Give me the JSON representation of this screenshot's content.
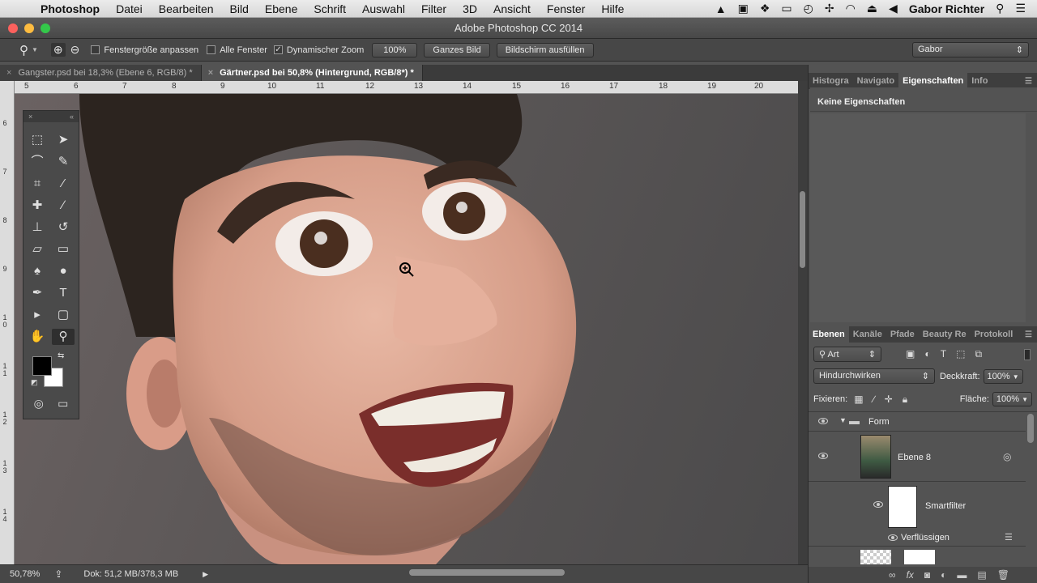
{
  "menubar": {
    "apple": "",
    "app": "Photoshop",
    "items": [
      "Datei",
      "Bearbeiten",
      "Bild",
      "Ebene",
      "Schrift",
      "Auswahl",
      "Filter",
      "3D",
      "Ansicht",
      "Fenster",
      "Hilfe"
    ],
    "user": "Gabor Richter"
  },
  "window": {
    "title": "Adobe Photoshop CC 2014"
  },
  "options": {
    "resize_window": "Fenstergröße anpassen",
    "all_windows": "Alle Fenster",
    "dynamic_zoom": "Dynamischer Zoom",
    "zoom_pct": "100%",
    "fit_screen": "Ganzes Bild",
    "fill_screen": "Bildschirm ausfüllen",
    "workspace": "Gabor"
  },
  "tabs": [
    {
      "label": "Gangster.psd bei 18,3% (Ebene 6, RGB/8) *",
      "close": "×"
    },
    {
      "label": "Gärtner.psd bei 50,8% (Hintergrund, RGB/8*) *",
      "close": "×"
    }
  ],
  "ruler": {
    "h": [
      "5",
      "6",
      "7",
      "8",
      "9",
      "10",
      "11",
      "12",
      "13",
      "14",
      "15",
      "16",
      "17",
      "18",
      "19",
      "20"
    ],
    "v": [
      "6",
      "7",
      "8",
      "9",
      "1 0",
      "1 1",
      "1 2",
      "1 3",
      "1 4"
    ]
  },
  "status": {
    "zoom": "50,78%",
    "doc": "Dok: 51,2 MB/378,3 MB"
  },
  "props_panel": {
    "tabs": [
      "Histogra",
      "Navigato",
      "Eigenschaften",
      "Info"
    ],
    "empty": "Keine Eigenschaften"
  },
  "layers_panel": {
    "tabs": [
      "Ebenen",
      "Kanäle",
      "Pfade",
      "Beauty Re",
      "Protokoll"
    ],
    "filter_kind": "Art",
    "blend_mode": "Hindurchwirken",
    "opacity_label": "Deckkraft:",
    "opacity": "100%",
    "lock_label": "Fixieren:",
    "fill_label": "Fläche:",
    "fill": "100%",
    "layers": [
      {
        "name": "Form",
        "type": "group"
      },
      {
        "name": "Ebene 8",
        "type": "smart-object"
      },
      {
        "name": "Smartfilter",
        "type": "filter-mask"
      },
      {
        "name": "Verflüssigen",
        "type": "filter"
      }
    ]
  },
  "colors": {
    "foreground": "#000000",
    "background": "#ffffff"
  },
  "icons": [
    "zoom-tool-icon",
    "zoom-in-icon",
    "zoom-out-icon",
    "marquee-icon",
    "move-icon",
    "lasso-icon",
    "quick-select-icon",
    "crop-icon",
    "eyedropper-icon",
    "healing-icon",
    "brush-icon",
    "stamp-icon",
    "history-brush-icon",
    "eraser-icon",
    "gradient-icon",
    "blur-icon",
    "dodge-icon",
    "pen-icon",
    "type-icon",
    "path-select-icon",
    "rectangle-icon",
    "hand-icon",
    "zoom-icon",
    "quickmask-icon",
    "screen-mode-icon"
  ]
}
